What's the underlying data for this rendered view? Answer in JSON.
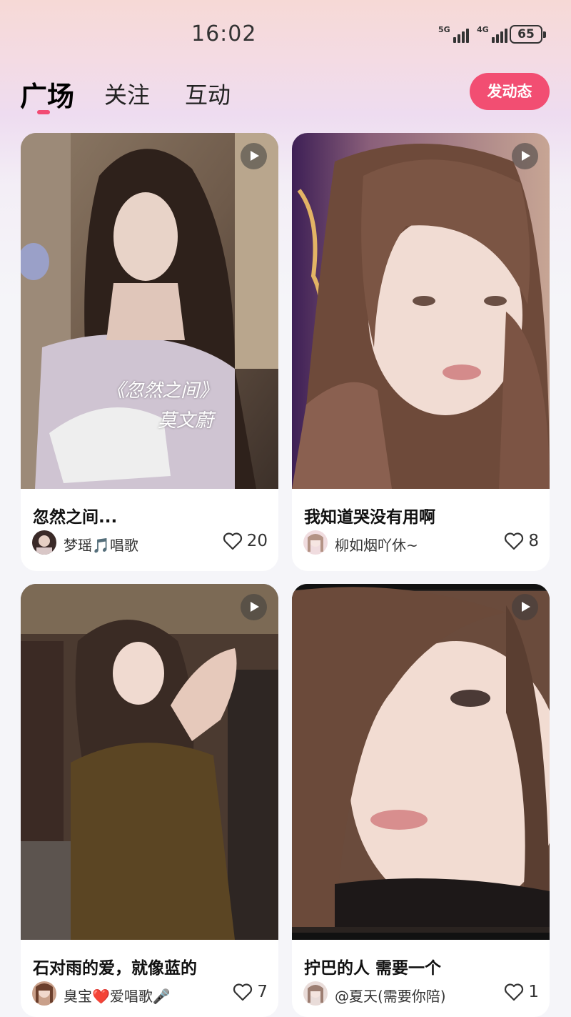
{
  "status_bar": {
    "time": "16:02",
    "network_1": "5G",
    "network_2": "4G",
    "battery": "65"
  },
  "tabs": [
    {
      "label": "广场",
      "active": true
    },
    {
      "label": "关注",
      "active": false
    },
    {
      "label": "互动",
      "active": false
    }
  ],
  "post_button": "发动态",
  "colors": {
    "accent": "#f24e72"
  },
  "posts": [
    {
      "title": "忽然之间...",
      "author": "梦瑶🎵唱歌",
      "likes": "20",
      "overlay_line1": "《忽然之间》",
      "overlay_line2": "莫文蔚",
      "has_video": true
    },
    {
      "title": "我知道哭没有用啊",
      "author": "柳如烟吖休~",
      "likes": "8",
      "has_video": true
    },
    {
      "title": "石对雨的爱，就像蓝的",
      "author": "臭宝❤️爱唱歌🎤",
      "likes": "7",
      "has_video": true
    },
    {
      "title": "拧巴的人  需要一个",
      "author": "@夏天(需要你陪)",
      "likes": "1",
      "has_video": true
    }
  ]
}
